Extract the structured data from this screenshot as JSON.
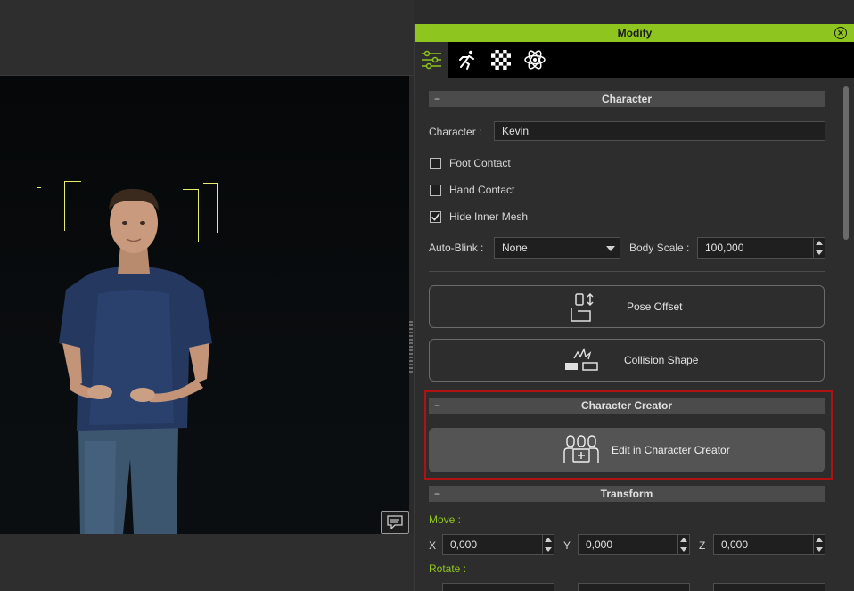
{
  "panel": {
    "title": "Modify",
    "tabs": [
      {
        "name": "attributes-tab",
        "icon": "sliders-icon",
        "active": true
      },
      {
        "name": "motion-tab",
        "icon": "running-figure-icon",
        "active": false
      },
      {
        "name": "material-tab",
        "icon": "checkerboard-icon",
        "active": false
      },
      {
        "name": "physics-tab",
        "icon": "atom-icon",
        "active": false
      }
    ]
  },
  "character": {
    "header": "Character",
    "collapse_symbol": "−",
    "name_label": "Character :",
    "name_value": "Kevin",
    "foot_contact_label": "Foot Contact",
    "foot_contact_checked": false,
    "hand_contact_label": "Hand Contact",
    "hand_contact_checked": false,
    "hide_inner_mesh_label": "Hide Inner Mesh",
    "hide_inner_mesh_checked": true,
    "auto_blink_label": "Auto-Blink :",
    "auto_blink_value": "None",
    "body_scale_label": "Body Scale :",
    "body_scale_value": "100,000",
    "pose_offset_label": "Pose Offset",
    "collision_shape_label": "Collision Shape"
  },
  "character_creator": {
    "header": "Character Creator",
    "collapse_symbol": "−",
    "edit_button_label": "Edit in Character Creator"
  },
  "transform": {
    "header": "Transform",
    "collapse_symbol": "−",
    "move_label": "Move :",
    "rotate_label": "Rotate :",
    "x_label": "X",
    "y_label": "Y",
    "z_label": "Z",
    "move_x": "0,000",
    "move_y": "0,000",
    "move_z": "0,000"
  },
  "colors": {
    "accent": "#8ec51f",
    "highlight_border": "#b01212"
  }
}
